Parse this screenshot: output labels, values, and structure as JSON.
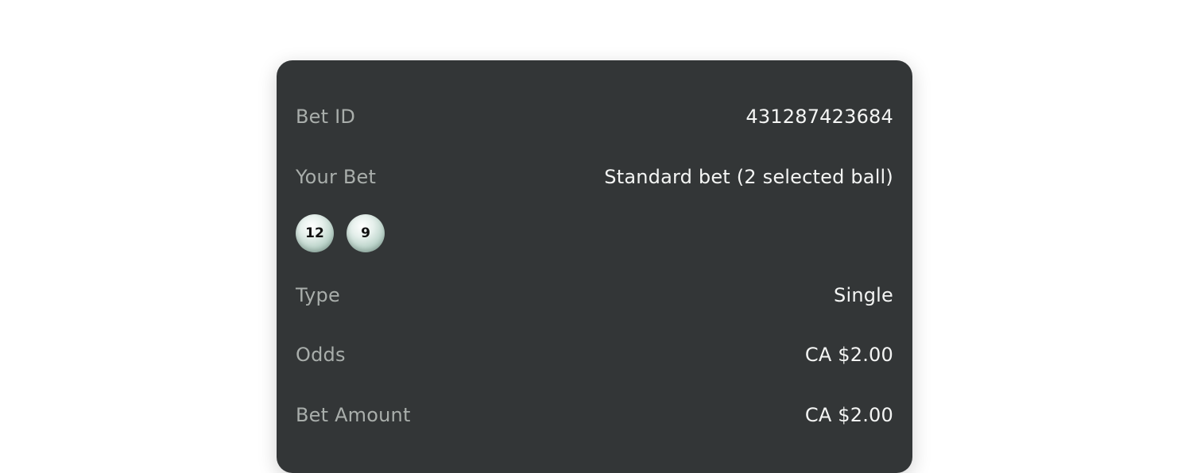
{
  "bet_details": {
    "bet_id": {
      "label": "Bet ID",
      "value": "431287423684"
    },
    "your_bet": {
      "label": "Your Bet",
      "value": "Standard bet (2 selected ball)"
    },
    "selected_balls": [
      "12",
      "9"
    ],
    "type": {
      "label": "Type",
      "value": "Single"
    },
    "odds": {
      "label": "Odds",
      "value": "CA $2.00"
    },
    "bet_amount": {
      "label": "Bet Amount",
      "value": "CA $2.00"
    }
  }
}
